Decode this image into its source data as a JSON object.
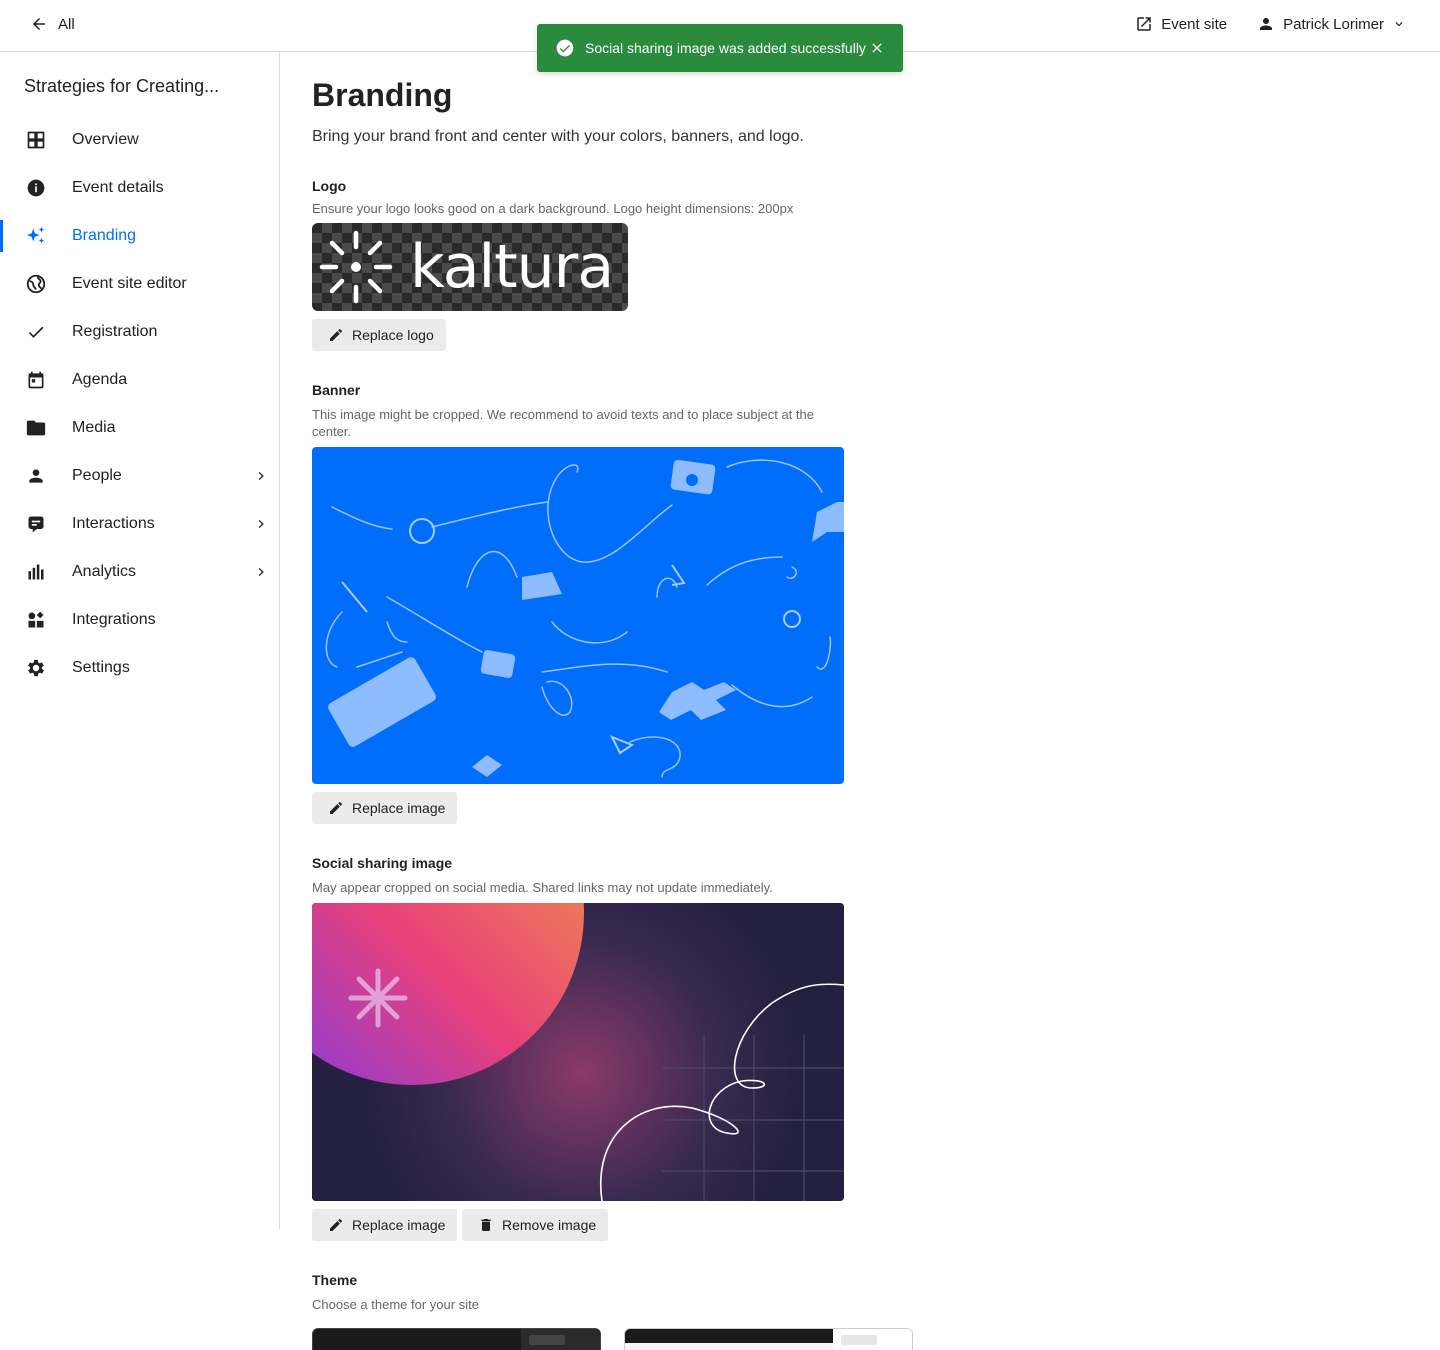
{
  "topbar": {
    "back_label": "All",
    "event_site_label": "Event site",
    "user_name": "Patrick Lorimer"
  },
  "toast": {
    "message": "Social sharing image was added successfully",
    "color": "#2a8a3e"
  },
  "sidebar": {
    "event_title": "Strategies for Creating...",
    "active_color": "#006efa",
    "items": [
      {
        "label": "Overview",
        "icon": "grid-icon"
      },
      {
        "label": "Event details",
        "icon": "info-icon"
      },
      {
        "label": "Branding",
        "icon": "sparkles-icon",
        "active": true
      },
      {
        "label": "Event site editor",
        "icon": "globe-icon"
      },
      {
        "label": "Registration",
        "icon": "check-icon"
      },
      {
        "label": "Agenda",
        "icon": "calendar-icon"
      },
      {
        "label": "Media",
        "icon": "folder-icon"
      },
      {
        "label": "People",
        "icon": "person-icon",
        "has_submenu": true
      },
      {
        "label": "Interactions",
        "icon": "chat-icon",
        "has_submenu": true
      },
      {
        "label": "Analytics",
        "icon": "bar-chart-icon",
        "has_submenu": true
      },
      {
        "label": "Integrations",
        "icon": "widgets-icon"
      },
      {
        "label": "Settings",
        "icon": "gear-icon"
      }
    ]
  },
  "main": {
    "title": "Branding",
    "description": "Bring your brand front and center with your colors, banners, and logo.",
    "logo": {
      "title": "Logo",
      "description": "Ensure your logo looks good on a dark background. Logo height dimensions: 200px",
      "logo_text": "kaltura",
      "replace_label": "Replace logo"
    },
    "banner": {
      "title": "Banner",
      "description": "This image might be cropped. We recommend to avoid texts and to place subject at the center.",
      "replace_label": "Replace image",
      "background_color": "#006efa"
    },
    "social": {
      "title": "Social sharing image",
      "description": "May appear cropped on social media. Shared links may not update immediately.",
      "replace_label": "Replace image",
      "remove_label": "Remove image"
    },
    "theme": {
      "title": "Theme",
      "description": "Choose a theme for your site"
    }
  }
}
